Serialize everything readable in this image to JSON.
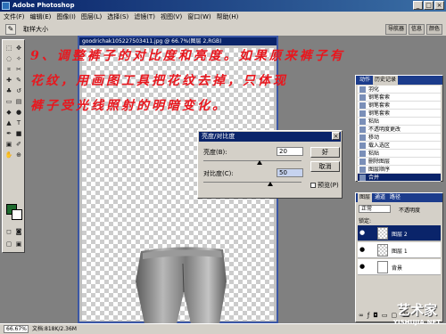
{
  "app": {
    "title": "Adobe Photoshop"
  },
  "menu": [
    "文件(F)",
    "编辑(E)",
    "图像(I)",
    "图层(L)",
    "选择(S)",
    "滤镜(T)",
    "视图(V)",
    "窗口(W)",
    "帮助(H)"
  ],
  "options": {
    "label": "取样大小",
    "right_tabs": [
      "导航器",
      "信息",
      "颜色"
    ]
  },
  "document": {
    "title": "goodrichak105227503411.jpg @ 66.7%(图层 2,RGB)"
  },
  "caption": {
    "lines": [
      "9、调整裤子的对比度和亮度。如果原来裤子有",
      "花纹，用画图工具把花纹去掉，只体现",
      "裤子受光线照射的明暗变化。"
    ]
  },
  "dialog": {
    "title": "亮度/对比度",
    "brightness_label": "亮度(B):",
    "brightness_value": "20",
    "contrast_label": "对比度(C):",
    "contrast_value": "50",
    "ok_label": "好",
    "cancel_label": "取消",
    "preview_label": "预览(P)"
  },
  "history": {
    "tabs": [
      "动作",
      "历史记录"
    ],
    "items": [
      "羽化",
      "钢笔套索",
      "钢笔套索",
      "钢笔套索",
      "粘贴",
      "不透明度更改",
      "移动",
      "载入选区",
      "粘贴",
      "删除图层",
      "图层顺序",
      "合并"
    ]
  },
  "layers": {
    "tabs": [
      "图层",
      "通道",
      "路径"
    ],
    "blend_mode": "正常",
    "opacity_label": "不透明度",
    "lock_label": "锁定:",
    "items": [
      "图层 2",
      "图层 1",
      "背景"
    ]
  },
  "status": {
    "zoom": "66.67%",
    "doc_size": "文档:818K/2.36M"
  },
  "watermark": {
    "big": "艺术家",
    "small": "YISHUJIA.NET"
  }
}
